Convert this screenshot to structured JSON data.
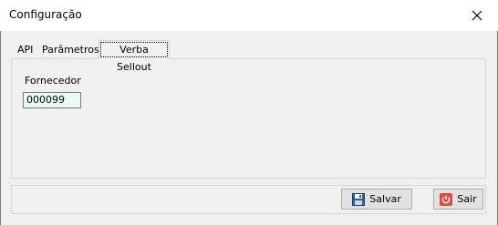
{
  "window": {
    "title": "Configuração"
  },
  "tabs": [
    {
      "label": "API"
    },
    {
      "label": "Parâmetros"
    },
    {
      "label": "Verba Sellout"
    }
  ],
  "form": {
    "fornecedor_label": "Fornecedor",
    "fornecedor_value": "000099"
  },
  "buttons": {
    "save_label": "Salvar",
    "exit_label": "Sair"
  },
  "icons": {
    "close": "close-icon",
    "save": "floppy-disk-icon",
    "exit": "power-icon"
  },
  "colors": {
    "input_bg": "#e8fbf2",
    "exit_icon": "#e04a3a"
  }
}
